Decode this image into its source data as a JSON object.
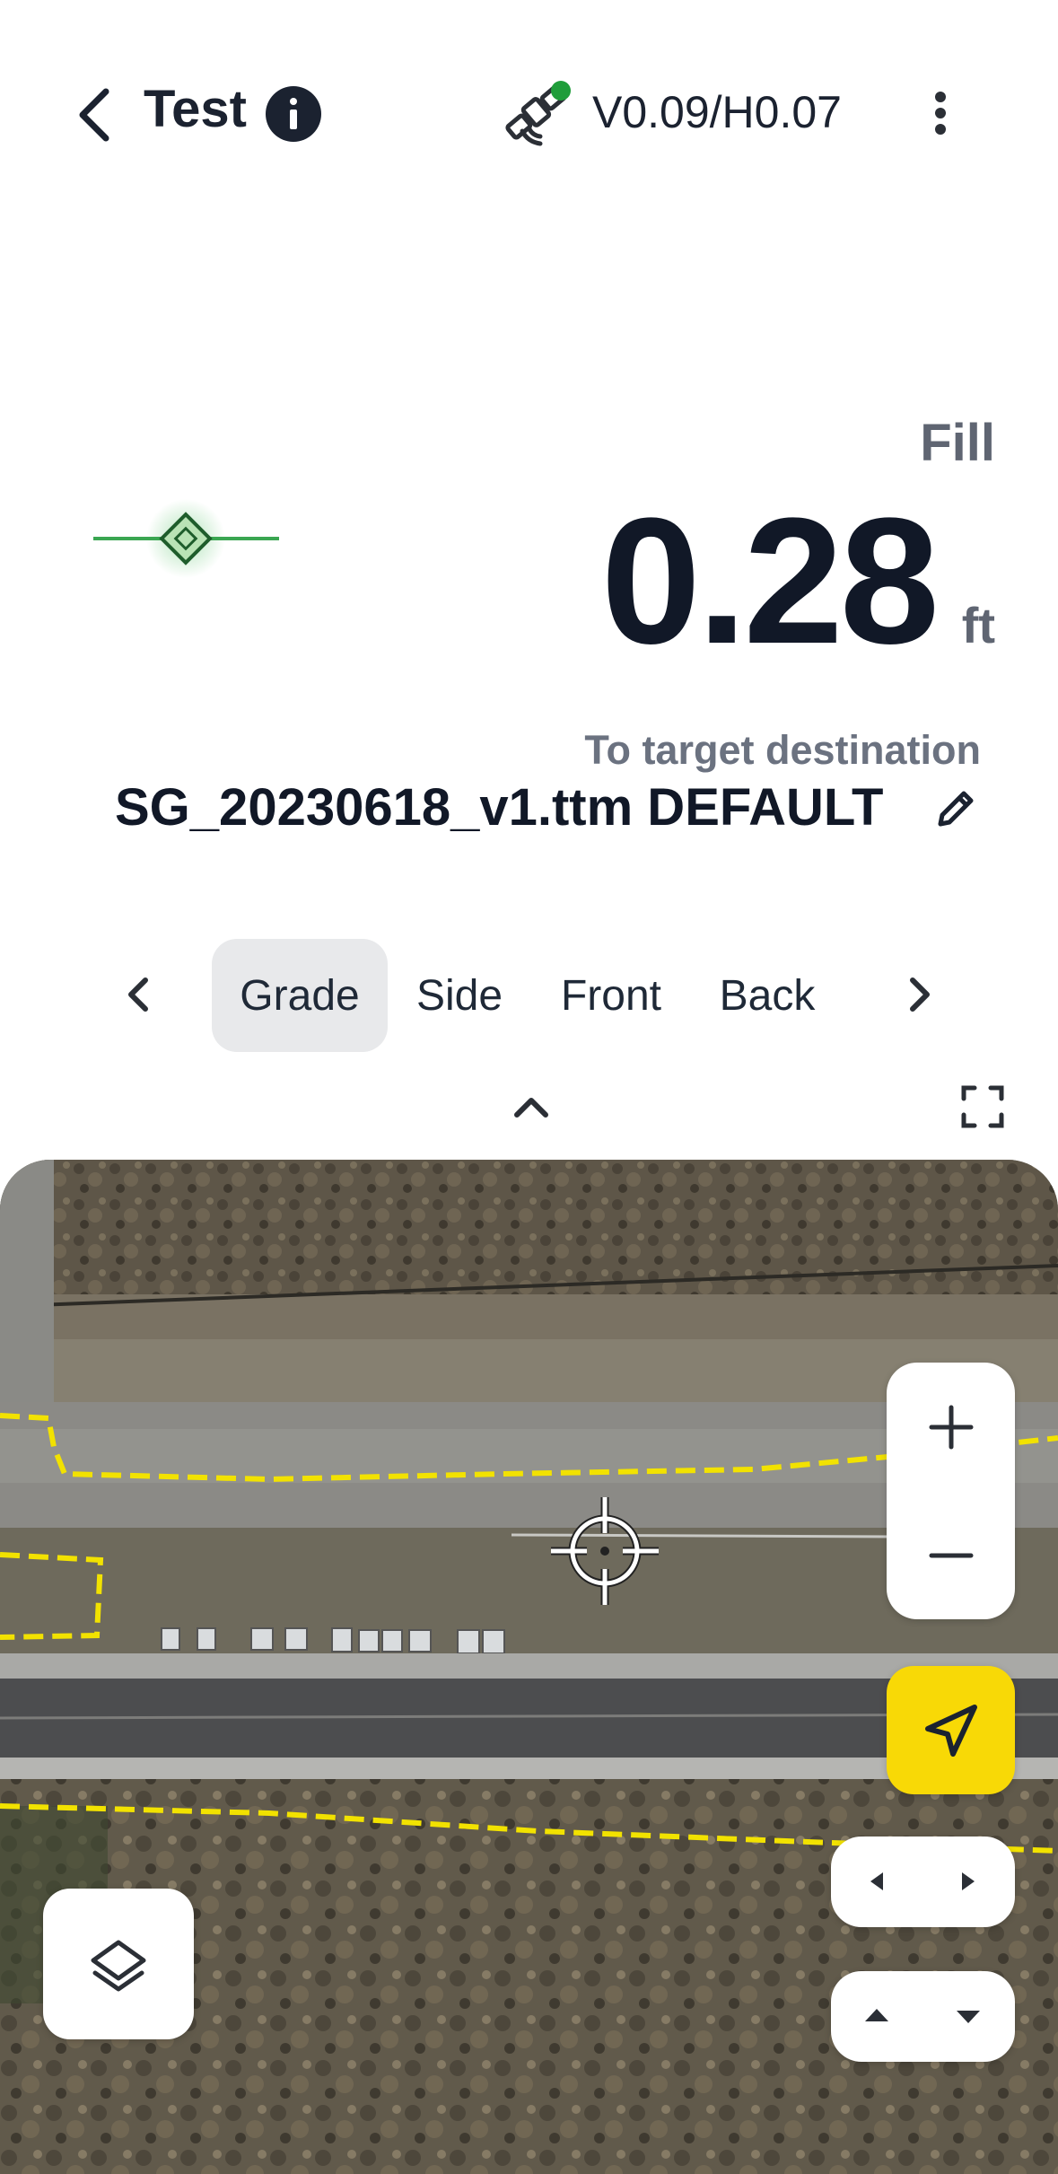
{
  "header": {
    "title": "Test",
    "back_icon": "chevron-left-icon",
    "info_icon": "info-icon",
    "gnss_icon": "satellite-icon",
    "gnss_status_color": "#1f9d3a",
    "accuracy": "V0.09/H0.07",
    "menu_icon": "more-vertical-icon"
  },
  "readout": {
    "mode": "Fill",
    "value": "0.28",
    "unit": "ft",
    "target_label": "To target destination",
    "surface": "SG_20230618_v1.ttm DEFAULT",
    "edit_icon": "pencil-icon",
    "indicator_color": "#2e9a45"
  },
  "tabs": {
    "prev_icon": "chevron-left-icon",
    "next_icon": "chevron-right-icon",
    "items": [
      {
        "label": "Grade",
        "active": true
      },
      {
        "label": "Side",
        "active": false
      },
      {
        "label": "Front",
        "active": false
      },
      {
        "label": "Back",
        "active": false
      }
    ]
  },
  "map": {
    "collapse_icon": "chevron-up-icon",
    "fullscreen_icon": "fullscreen-icon",
    "zoom_in_icon": "plus-icon",
    "zoom_out_icon": "minus-icon",
    "locate_icon": "navigation-arrow-icon",
    "locate_color": "#f8d906",
    "pan_left_icon": "triangle-left-icon",
    "pan_right_icon": "triangle-right-icon",
    "pan_up_icon": "triangle-up-icon",
    "pan_down_icon": "triangle-down-icon",
    "layers_icon": "layers-icon",
    "boundary_color": "#f2e200",
    "crosshair_icon": "crosshair-icon"
  }
}
